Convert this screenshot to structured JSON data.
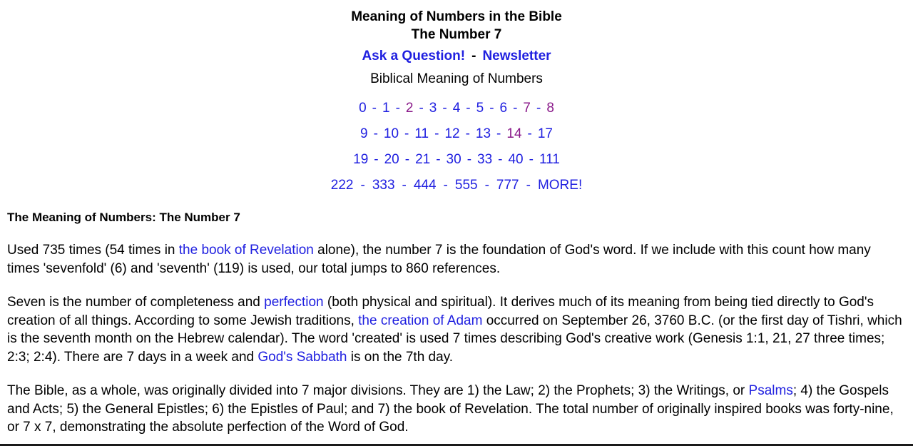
{
  "header": {
    "title": "Meaning of Numbers in the Bible",
    "subtitle": "The Number 7",
    "links": {
      "ask": "Ask a Question!",
      "separator": "-",
      "newsletter": "Newsletter"
    },
    "caption": "Biblical Meaning of Numbers"
  },
  "colors": {
    "link": "#2020e0",
    "visited_link": "#8a1a8a",
    "text": "#000000",
    "background": "#ffffff"
  },
  "number_rows": [
    {
      "separator": "-",
      "items": [
        {
          "label": "0",
          "visited": false
        },
        {
          "label": "1",
          "visited": false
        },
        {
          "label": "2",
          "visited": true
        },
        {
          "label": "3",
          "visited": false
        },
        {
          "label": "4",
          "visited": false
        },
        {
          "label": "5",
          "visited": false
        },
        {
          "label": "6",
          "visited": false
        },
        {
          "label": "7",
          "visited": true
        },
        {
          "label": "8",
          "visited": true
        }
      ]
    },
    {
      "separator": "-",
      "items": [
        {
          "label": "9",
          "visited": false
        },
        {
          "label": "10",
          "visited": false
        },
        {
          "label": "11",
          "visited": false
        },
        {
          "label": "12",
          "visited": false
        },
        {
          "label": "13",
          "visited": false
        },
        {
          "label": "14",
          "visited": true
        },
        {
          "label": "17",
          "visited": false
        }
      ]
    },
    {
      "separator": "-",
      "items": [
        {
          "label": "19",
          "visited": false
        },
        {
          "label": "20",
          "visited": false
        },
        {
          "label": "21",
          "visited": false
        },
        {
          "label": "30",
          "visited": false
        },
        {
          "label": "33",
          "visited": false
        },
        {
          "label": "40",
          "visited": false
        },
        {
          "label": "111",
          "visited": false
        }
      ]
    },
    {
      "separator": "-",
      "items": [
        {
          "label": "222",
          "visited": false
        },
        {
          "label": "333",
          "visited": false
        },
        {
          "label": "444",
          "visited": false
        },
        {
          "label": "555",
          "visited": false
        },
        {
          "label": "777",
          "visited": false
        },
        {
          "label": "MORE!",
          "visited": false
        }
      ]
    }
  ],
  "main": {
    "section_heading": "The Meaning of Numbers: The Number 7",
    "paragraphs": [
      {
        "id": "para-1",
        "runs": [
          {
            "type": "text",
            "text": "Used 735 times (54 times in "
          },
          {
            "type": "link",
            "text": "the book of Revelation"
          },
          {
            "type": "text",
            "text": " alone), the number 7 is the foundation of God's word. If we include with this count how many times 'sevenfold' (6) and 'seventh' (119) is used, our total jumps to 860 references."
          }
        ]
      },
      {
        "id": "para-2",
        "runs": [
          {
            "type": "text",
            "text": "Seven is the number of completeness and "
          },
          {
            "type": "link",
            "text": "perfection"
          },
          {
            "type": "text",
            "text": " (both physical and spiritual). It derives much of its meaning from being tied directly to God's creation of all things. According to some Jewish traditions, "
          },
          {
            "type": "link",
            "text": "the creation of Adam"
          },
          {
            "type": "text",
            "text": " occurred on September 26, 3760 B.C. (or the first day of Tishri, which is the seventh month on the Hebrew calendar). The word 'created' is used 7 times describing God's creative work (Genesis 1:1, 21, 27 three times; 2:3; 2:4). There are 7 days in a week and "
          },
          {
            "type": "link",
            "text": "God's Sabbath"
          },
          {
            "type": "text",
            "text": " is on the 7th day."
          }
        ]
      },
      {
        "id": "para-3",
        "runs": [
          {
            "type": "text",
            "text": "The Bible, as a whole, was originally divided into 7 major divisions. They are 1) the Law; 2) the Prophets; 3) the Writings, or "
          },
          {
            "type": "link",
            "text": "Psalms"
          },
          {
            "type": "text",
            "text": "; 4) the Gospels and Acts; 5) the General Epistles; 6) the Epistles of Paul; and 7) the book of Revelation. The total number of originally inspired books was forty-nine, or 7 x 7, demonstrating the absolute perfection of the Word of God."
          }
        ]
      }
    ]
  }
}
